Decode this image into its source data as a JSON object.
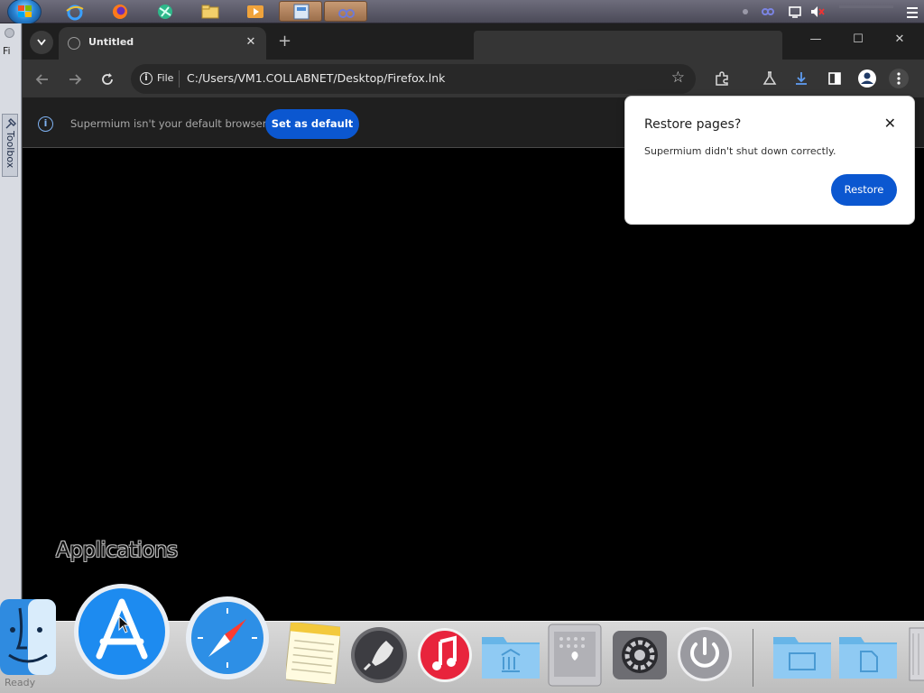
{
  "browser": {
    "tab_search_icon": "chevron-down",
    "tab": {
      "title": "Untitled",
      "close": "✕"
    },
    "new_tab": "+",
    "window_controls": {
      "minimize": "—",
      "maximize": "☐",
      "close": "✕"
    },
    "address": {
      "chip": "File",
      "url": "C:/Users/VM1.COLLABNET/Desktop/Firefox.lnk"
    }
  },
  "infobar": {
    "message": "Supermium isn't your default browser",
    "button": "Set as default"
  },
  "restore_popup": {
    "title": "Restore pages?",
    "message": "Supermium didn't shut down correctly.",
    "button": "Restore",
    "close": "✕"
  },
  "toolbox": {
    "label": "Toolbox",
    "fi_text": "Fi"
  },
  "desktop": {
    "apps_label": "Applications",
    "status": "Ready"
  },
  "icons": {
    "taskbar": [
      "start-orb",
      "internet-explorer",
      "firefox",
      "chrome-like",
      "folder",
      "media-player",
      "taskbar-app-1",
      "taskbar-app-2"
    ],
    "dock": [
      "finder",
      "app-store",
      "safari",
      "notes",
      "launchpad",
      "itunes",
      "documents-folder",
      "mac-pro",
      "system-preferences",
      "power",
      "folder",
      "file-folder",
      "trash"
    ]
  },
  "colors": {
    "accent": "#0b57d0",
    "info_blue": "#7fb2f2"
  }
}
